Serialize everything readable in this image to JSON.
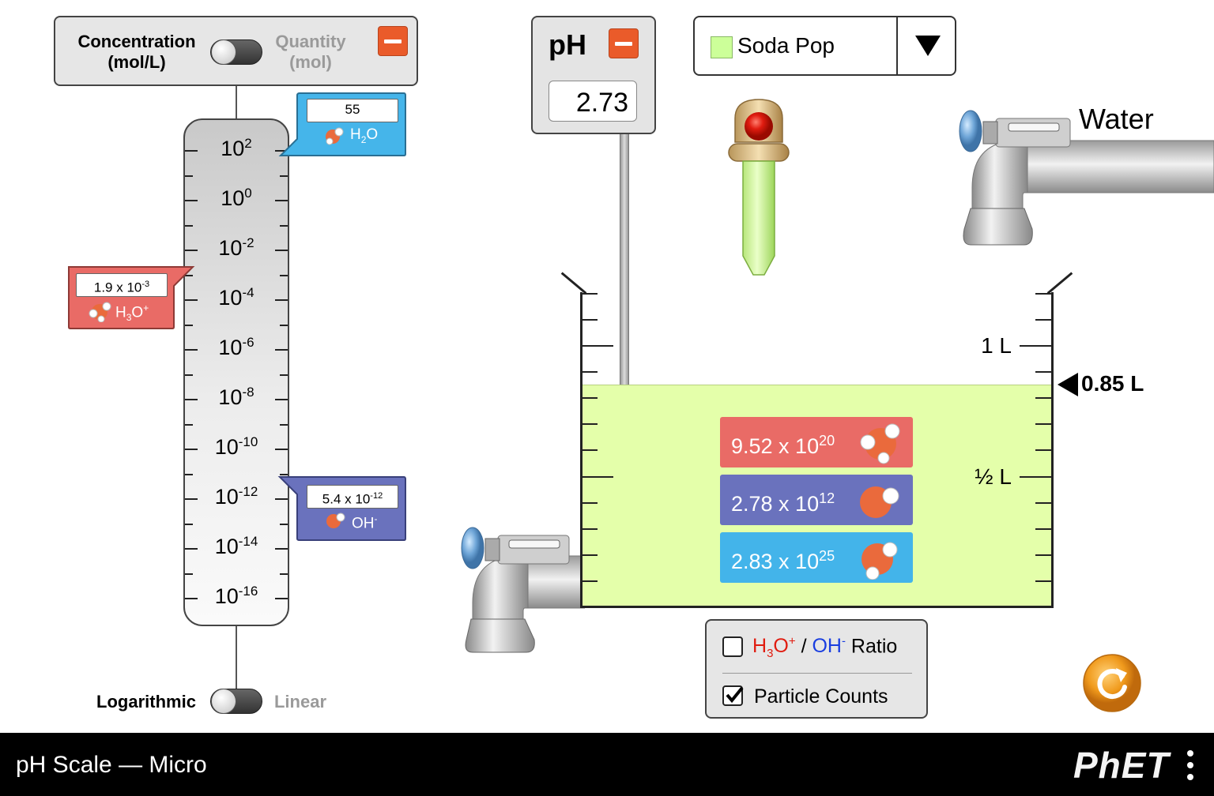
{
  "graph_panel": {
    "toggle_left": [
      "Concentration",
      "(mol/L)"
    ],
    "toggle_right": [
      "Quantity",
      "(mol)"
    ],
    "scale_toggle_left": "Logarithmic",
    "scale_toggle_right": "Linear"
  },
  "graph": {
    "tick_labels": [
      {
        "base": "10",
        "exp": "2"
      },
      {
        "base": "10",
        "exp": "0"
      },
      {
        "base": "10",
        "exp": "-2"
      },
      {
        "base": "10",
        "exp": "-4"
      },
      {
        "base": "10",
        "exp": "-6"
      },
      {
        "base": "10",
        "exp": "-8"
      },
      {
        "base": "10",
        "exp": "-10"
      },
      {
        "base": "10",
        "exp": "-12"
      },
      {
        "base": "10",
        "exp": "-14"
      },
      {
        "base": "10",
        "exp": "-16"
      }
    ],
    "h2o": {
      "value": "55",
      "label_main": "H",
      "label_sub": "2",
      "label_end": "O"
    },
    "h3o": {
      "mantissa": "1.9 x 10",
      "exp": "-3",
      "label_main": "H",
      "label_sub": "3",
      "label_end": "O",
      "label_sup": "+"
    },
    "oh": {
      "mantissa": "5.4 x 10",
      "exp": "-12",
      "label_main": "OH",
      "label_sup": "-"
    }
  },
  "ph_meter": {
    "title": "pH",
    "value": "2.73"
  },
  "solute": {
    "selected": "Soda Pop",
    "swatch_color": "#ccff99"
  },
  "faucets": {
    "water_label": "Water"
  },
  "beaker": {
    "label_1L": "1 L",
    "label_half": "½ L",
    "volume_indicator": "0.85 L",
    "liquid_color": "#e4ffaa",
    "liquid_fraction": 0.85
  },
  "particle_counts": [
    {
      "mantissa": "9.52 x 10",
      "exp": "20",
      "color": "#e96b66"
    },
    {
      "mantissa": "2.78 x 10",
      "exp": "12",
      "color": "#6a72bd"
    },
    {
      "mantissa": "2.83 x 10",
      "exp": "25",
      "color": "#43b4ea"
    }
  ],
  "options": {
    "ratio_h": "H",
    "ratio_sub": "3",
    "ratio_o": "O",
    "ratio_sup": "+",
    "ratio_slash": " / ",
    "ratio_oh": "OH",
    "ratio_oh_sup": "-",
    "ratio_word": " Ratio",
    "ratio_checked": false,
    "particle_counts_label": "Particle Counts",
    "particle_counts_checked": true
  },
  "nav": {
    "title": "pH Scale — Micro",
    "brand": "PhET"
  }
}
